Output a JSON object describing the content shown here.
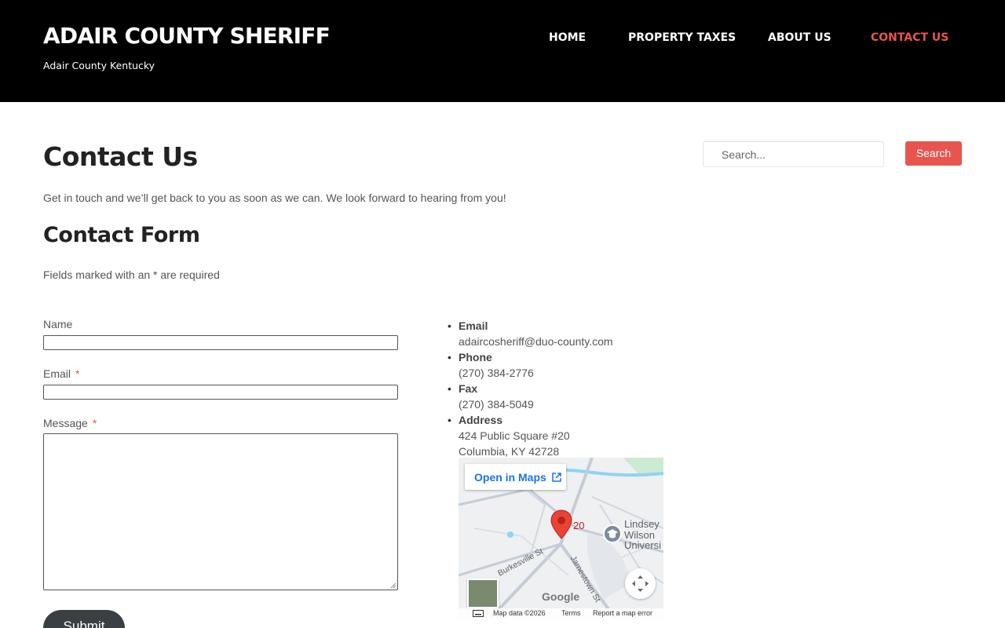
{
  "site": {
    "title": "ADAIR COUNTY SHERIFF",
    "tagline": "Adair County Kentucky"
  },
  "nav": {
    "items": [
      {
        "label": "HOME"
      },
      {
        "label": "PROPERTY TAXES"
      },
      {
        "label": "ABOUT US"
      },
      {
        "label": "CONTACT US",
        "active": true
      }
    ]
  },
  "search": {
    "placeholder": "Search...",
    "button_label": "Search"
  },
  "page": {
    "title": "Contact Us",
    "intro": "Get in touch and we’ll get back to you as soon as we can. We look forward to hearing from you!"
  },
  "form": {
    "title": "Contact Form",
    "required_note": "Fields marked with an * are required",
    "fields": [
      {
        "label": "Name",
        "required": false,
        "value": ""
      },
      {
        "label": "Email",
        "required": true,
        "value": ""
      },
      {
        "label": "Message",
        "required": true,
        "value": ""
      }
    ],
    "required_marker": "*",
    "submit_label": "Submit"
  },
  "contact_info": [
    {
      "label": "Email",
      "values": [
        "adaircosheriff@duo-county.com"
      ]
    },
    {
      "label": "Phone",
      "values": [
        "(270) 384-2776"
      ]
    },
    {
      "label": "Fax",
      "values": [
        "(270) 384-5049"
      ]
    },
    {
      "label": "Address",
      "values": [
        "424 Public Square #20",
        "Columbia, KY 42728"
      ]
    }
  ],
  "map": {
    "open_in_maps": "Open in Maps",
    "pin_label": "20",
    "poi_label": [
      "Lindsey",
      "Wilson",
      "Universi"
    ],
    "street_1": "Burkesville St",
    "street_2": "Jamestown St",
    "logo": "Google",
    "footer": {
      "data": "Map data ©2026",
      "terms": "Terms",
      "report": "Report a map error"
    }
  },
  "colors": {
    "header_bg": "#000000",
    "accent": "#e8554e",
    "submit_bg": "#3a3f44"
  }
}
